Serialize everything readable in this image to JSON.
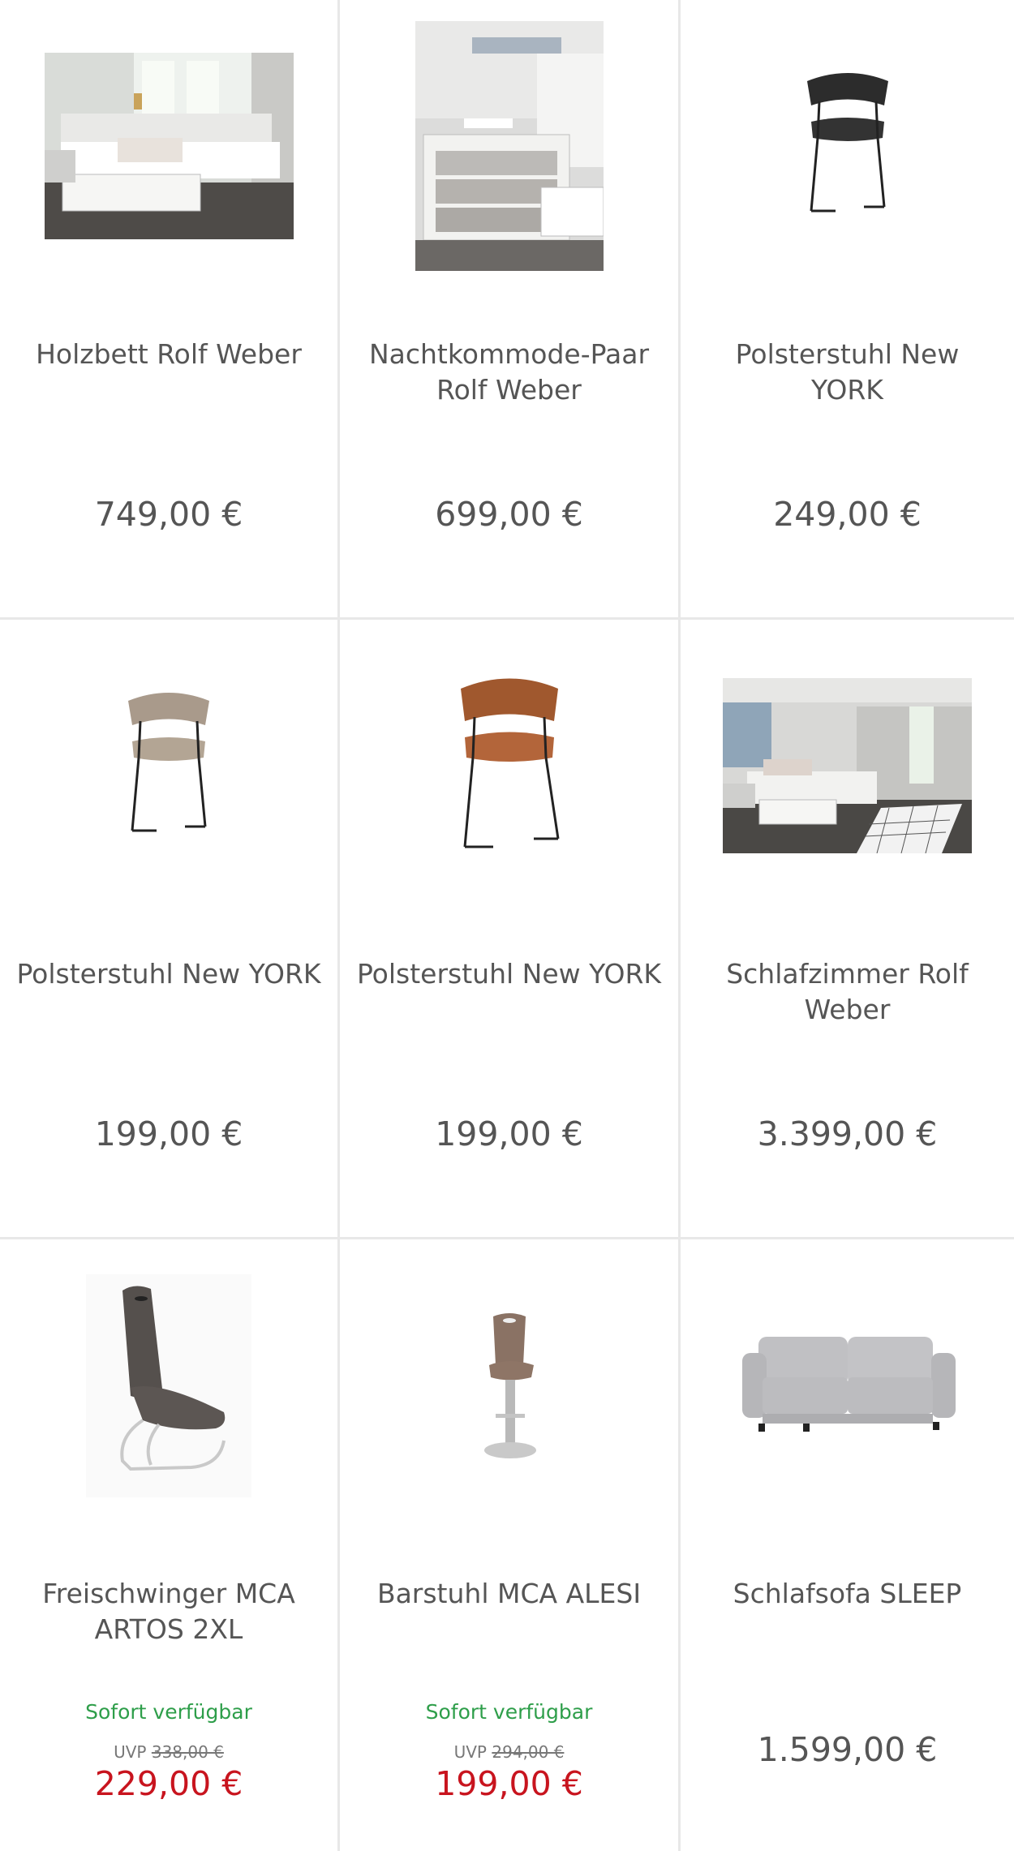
{
  "products": [
    {
      "title": "Holzbett Rolf Weber",
      "price": "749,00 €",
      "image": "bed-photo"
    },
    {
      "title": "Nachtkommode-Paar Rolf Weber",
      "price": "699,00 €",
      "image": "nightstand-photo"
    },
    {
      "title": "Polsterstuhl New YORK",
      "price": "249,00 €",
      "image": "black-chair-photo"
    },
    {
      "title": "Polsterstuhl New YORK",
      "price": "199,00 €",
      "image": "beige-chair-photo"
    },
    {
      "title": "Polsterstuhl New YORK",
      "price": "199,00 €",
      "image": "cognac-chair-photo"
    },
    {
      "title": "Schlafzimmer Rolf Weber",
      "price": "3.399,00 €",
      "image": "bedroom-photo"
    },
    {
      "title": "Freischwinger MCA ARTOS 2XL",
      "availability": "Sofort verfügbar",
      "uvp_label": "UVP",
      "uvp_price": "338,00 €",
      "sale_price": "229,00 €",
      "image": "cantilever-chair-photo"
    },
    {
      "title": "Barstuhl MCA ALESI",
      "availability": "Sofort verfügbar",
      "uvp_label": "UVP",
      "uvp_price": "294,00 €",
      "sale_price": "199,00 €",
      "image": "bar-stool-photo"
    },
    {
      "title": "Schlafsofa SLEEP",
      "price": "1.599,00 €",
      "image": "sofa-photo"
    }
  ],
  "colors": {
    "price": "#555555",
    "sale": "#c8141e",
    "availability": "#2e9e4a",
    "divider": "#e8e8e8"
  }
}
